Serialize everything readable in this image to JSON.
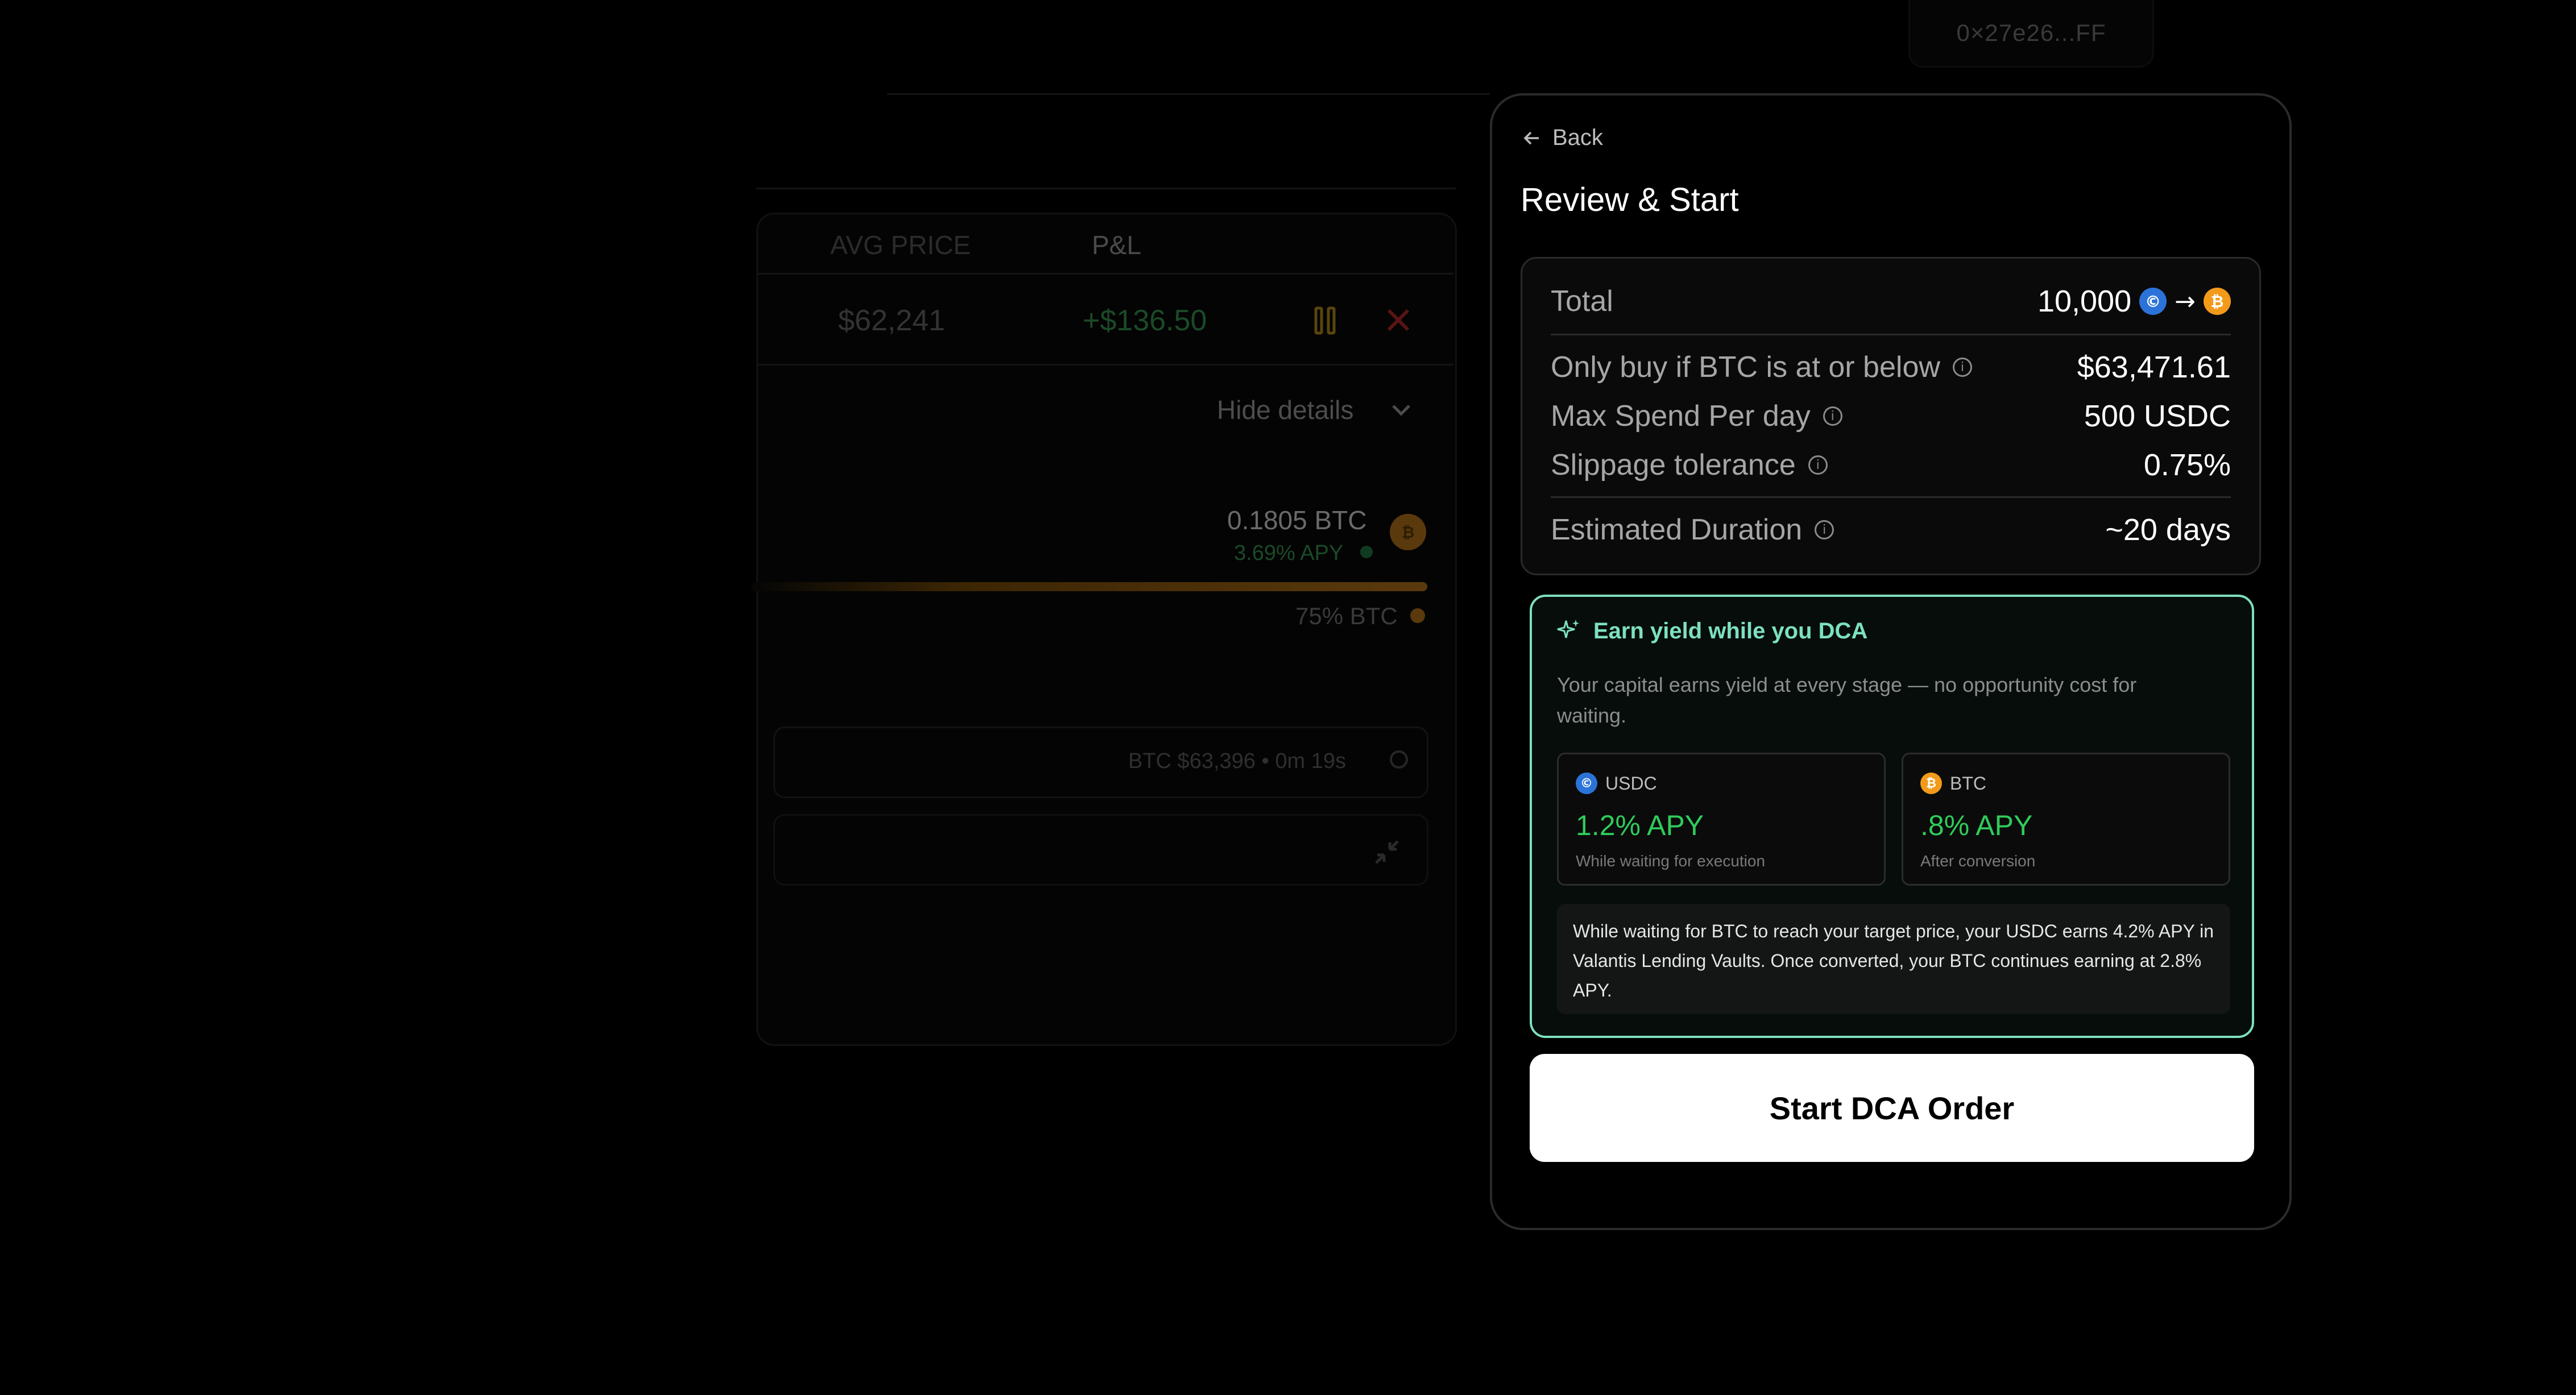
{
  "wallet": {
    "address": "0×27e26...FF"
  },
  "background": {
    "columns": {
      "avg_price": "AVG PRICE",
      "pnl": "P&L"
    },
    "position_row": {
      "avg_price": "$62,241",
      "pnl": "+$136.50"
    },
    "hide_details": "Hide details",
    "holding": {
      "amount": "0.1805 BTC",
      "apy": "3.69% APY"
    },
    "allocation": "75% BTC",
    "status": "BTC $63,396 • 0m 19s"
  },
  "modal": {
    "back_label": "Back",
    "title": "Review & Start",
    "summary": {
      "total_label": "Total",
      "total_value": "10,000",
      "rows": [
        {
          "label": "Only buy if BTC is at or below",
          "value": "$63,471.61"
        },
        {
          "label": "Max Spend Per day",
          "value": "500 USDC"
        },
        {
          "label": "Slippage tolerance",
          "value": "0.75%"
        }
      ],
      "duration_label": "Estimated Duration",
      "duration_value": "~20 days"
    },
    "yield": {
      "heading": "Earn yield while you DCA",
      "subtitle": "Your capital earns yield at every stage — no opportunity cost for waiting.",
      "usdc": {
        "name": "USDC",
        "apy": "1.2% APY",
        "note": "While waiting for execution"
      },
      "btc": {
        "name": "BTC",
        "apy": ".8% APY",
        "note": "After conversion"
      },
      "explanation": "While waiting for BTC to reach your target price, your USDC earns 4.2% APY in Valantis Lending Vaults. Once converted, your BTC continues earning at 2.8% APY."
    },
    "start_button": "Start DCA Order"
  },
  "colors": {
    "accent": "#7de0c0",
    "green": "#2fcc5a",
    "usdc": "#2b73d9",
    "btc": "#f29a1a"
  }
}
